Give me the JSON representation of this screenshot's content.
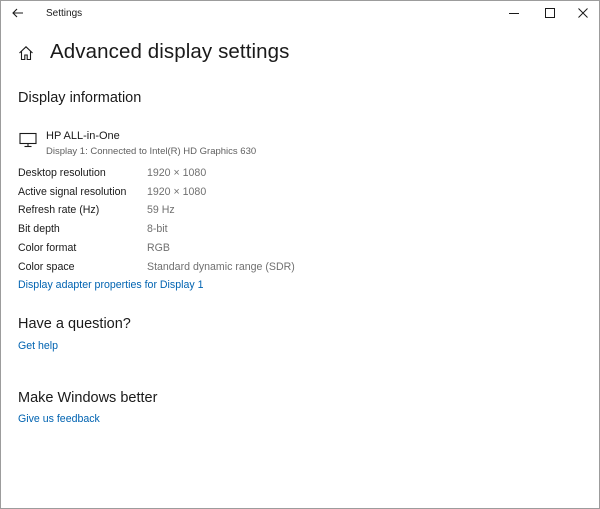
{
  "window": {
    "title": "Settings"
  },
  "page": {
    "title": "Advanced display settings"
  },
  "display_info": {
    "heading": "Display information",
    "device_name": "HP ALL-in-One",
    "device_detail": "Display 1: Connected to Intel(R) HD Graphics 630",
    "rows": [
      {
        "label": "Desktop resolution",
        "value": "1920 × 1080"
      },
      {
        "label": "Active signal resolution",
        "value": "1920 × 1080"
      },
      {
        "label": "Refresh rate (Hz)",
        "value": "59 Hz"
      },
      {
        "label": "Bit depth",
        "value": "8-bit"
      },
      {
        "label": "Color format",
        "value": "RGB"
      },
      {
        "label": "Color space",
        "value": "Standard dynamic range (SDR)"
      }
    ],
    "adapter_link": "Display adapter properties for Display 1"
  },
  "question": {
    "heading": "Have a question?",
    "link": "Get help"
  },
  "feedback": {
    "heading": "Make Windows better",
    "link": "Give us feedback"
  },
  "colors": {
    "accent_link": "#0063b1",
    "secondary_text": "#707070"
  },
  "icons": {
    "back": "back-arrow-icon",
    "minimize": "minimize-icon",
    "maximize": "maximize-icon",
    "close": "close-icon",
    "home": "home-icon",
    "monitor": "monitor-icon"
  }
}
